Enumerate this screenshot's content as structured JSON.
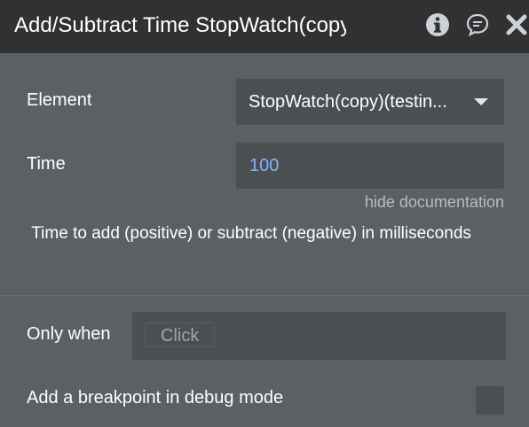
{
  "header": {
    "title": "Add/Subtract Time StopWatch(copy)(testing)",
    "icons": [
      "info-icon",
      "comment-icon",
      "close-icon"
    ]
  },
  "fields": {
    "element": {
      "label": "Element",
      "value": "StopWatch(copy)(testin..."
    },
    "time": {
      "label": "Time",
      "value": "100"
    }
  },
  "documentation": {
    "toggle_label": "hide documentation",
    "text": " Time to add (positive) or subtract (negative) in milliseconds"
  },
  "conditions": {
    "only_when_label": "Only when",
    "only_when_chip": "Click",
    "breakpoint_label": "Add a breakpoint in debug mode",
    "breakpoint_checked": false
  },
  "colors": {
    "background": "#5d6063",
    "titlebar": "#2f3133",
    "field": "#4c4f52",
    "value_accent": "#7fb5ff",
    "muted_text": "#b8bbbf"
  }
}
